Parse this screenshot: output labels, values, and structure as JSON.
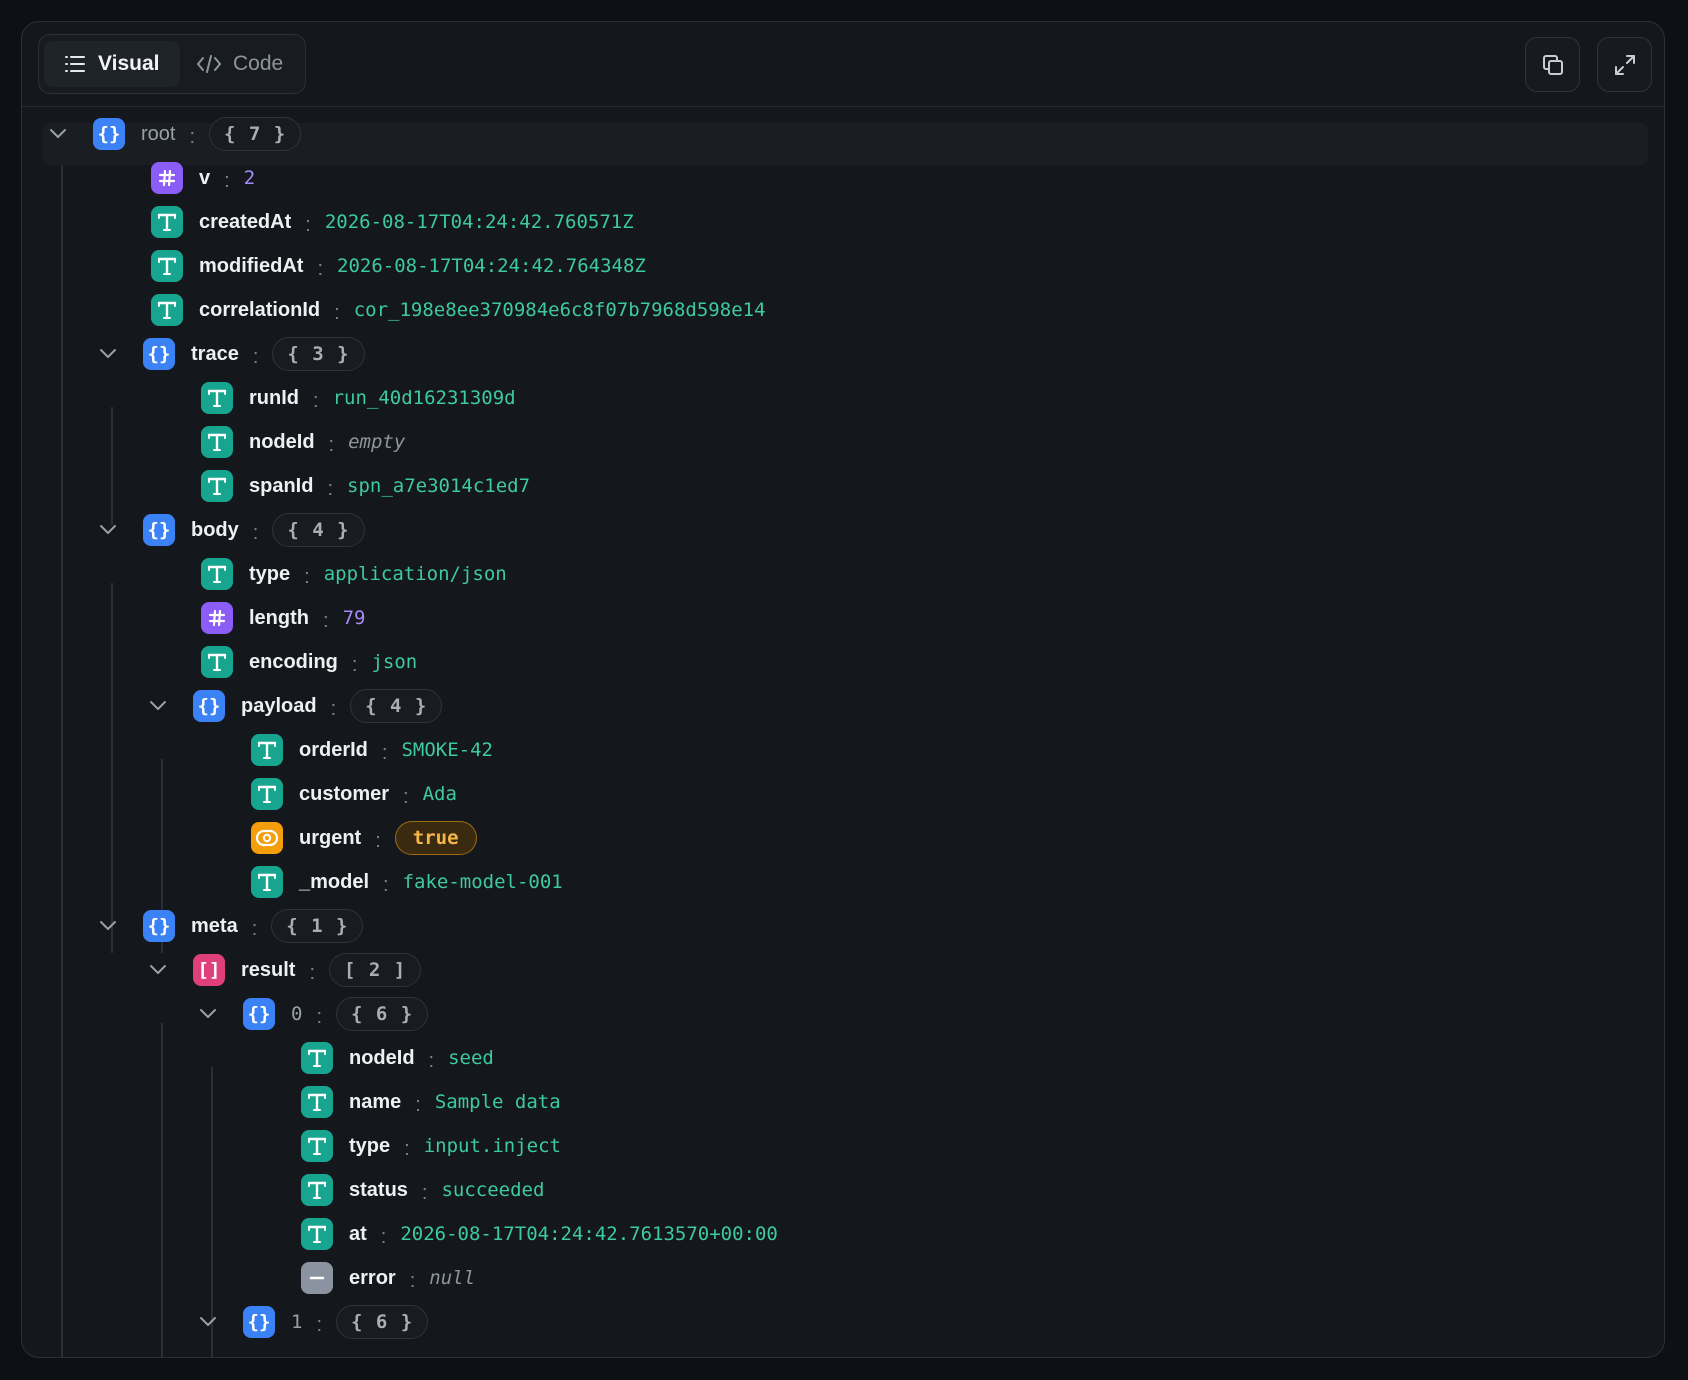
{
  "toolbar": {
    "tabs": [
      {
        "label": "Visual",
        "icon": "list-icon",
        "active": true
      },
      {
        "label": "Code",
        "icon": "code-icon",
        "active": false
      }
    ],
    "actions": [
      {
        "icon": "copy-icon"
      },
      {
        "icon": "expand-icon"
      }
    ]
  },
  "colors": {
    "string": "#3dc9a3",
    "number": "#a78bfa",
    "object": "#3b82f6",
    "array": "#e0407a",
    "boolean": "#f59e0b",
    "null": "#8a939f"
  },
  "tree": [
    {
      "depth": 0,
      "kind": "object",
      "key": "root",
      "count": "{ 7 }",
      "expanded": true
    },
    {
      "depth": 1,
      "kind": "number",
      "key": "v",
      "value": "2"
    },
    {
      "depth": 1,
      "kind": "string",
      "key": "createdAt",
      "value": "2026-08-17T04:24:42.760571Z"
    },
    {
      "depth": 1,
      "kind": "string",
      "key": "modifiedAt",
      "value": "2026-08-17T04:24:42.764348Z"
    },
    {
      "depth": 1,
      "kind": "string",
      "key": "correlationId",
      "value": "cor_198e8ee370984e6c8f07b7968d598e14"
    },
    {
      "depth": 1,
      "kind": "object",
      "key": "trace",
      "count": "{ 3 }",
      "expanded": true
    },
    {
      "depth": 2,
      "kind": "string",
      "key": "runId",
      "value": "run_40d16231309d"
    },
    {
      "depth": 2,
      "kind": "empty",
      "key": "nodeId",
      "value": "empty"
    },
    {
      "depth": 2,
      "kind": "string",
      "key": "spanId",
      "value": "spn_a7e3014c1ed7"
    },
    {
      "depth": 1,
      "kind": "object",
      "key": "body",
      "count": "{ 4 }",
      "expanded": true
    },
    {
      "depth": 2,
      "kind": "string",
      "key": "type",
      "value": "application/json"
    },
    {
      "depth": 2,
      "kind": "number",
      "key": "length",
      "value": "79"
    },
    {
      "depth": 2,
      "kind": "string",
      "key": "encoding",
      "value": "json"
    },
    {
      "depth": 2,
      "kind": "object",
      "key": "payload",
      "count": "{ 4 }",
      "expanded": true
    },
    {
      "depth": 3,
      "kind": "string",
      "key": "orderId",
      "value": "SMOKE-42"
    },
    {
      "depth": 3,
      "kind": "string",
      "key": "customer",
      "value": "Ada"
    },
    {
      "depth": 3,
      "kind": "boolean",
      "key": "urgent",
      "value": "true"
    },
    {
      "depth": 3,
      "kind": "string",
      "key": "_model",
      "value": "fake-model-001"
    },
    {
      "depth": 1,
      "kind": "object",
      "key": "meta",
      "count": "{ 1 }",
      "expanded": true
    },
    {
      "depth": 2,
      "kind": "array",
      "key": "result",
      "count": "[ 2 ]",
      "expanded": true
    },
    {
      "depth": 3,
      "kind": "object",
      "key": "0",
      "count": "{ 6 }",
      "expanded": true,
      "index": true
    },
    {
      "depth": 4,
      "kind": "string",
      "key": "nodeId",
      "value": "seed"
    },
    {
      "depth": 4,
      "kind": "string",
      "key": "name",
      "value": "Sample data"
    },
    {
      "depth": 4,
      "kind": "string",
      "key": "type",
      "value": "input.inject"
    },
    {
      "depth": 4,
      "kind": "string",
      "key": "status",
      "value": "succeeded"
    },
    {
      "depth": 4,
      "kind": "string",
      "key": "at",
      "value": "2026-08-17T04:24:42.7613570+00:00"
    },
    {
      "depth": 4,
      "kind": "null",
      "key": "error",
      "value": "null"
    },
    {
      "depth": 3,
      "kind": "object",
      "key": "1",
      "count": "{ 6 }",
      "expanded": true,
      "index": true
    }
  ]
}
